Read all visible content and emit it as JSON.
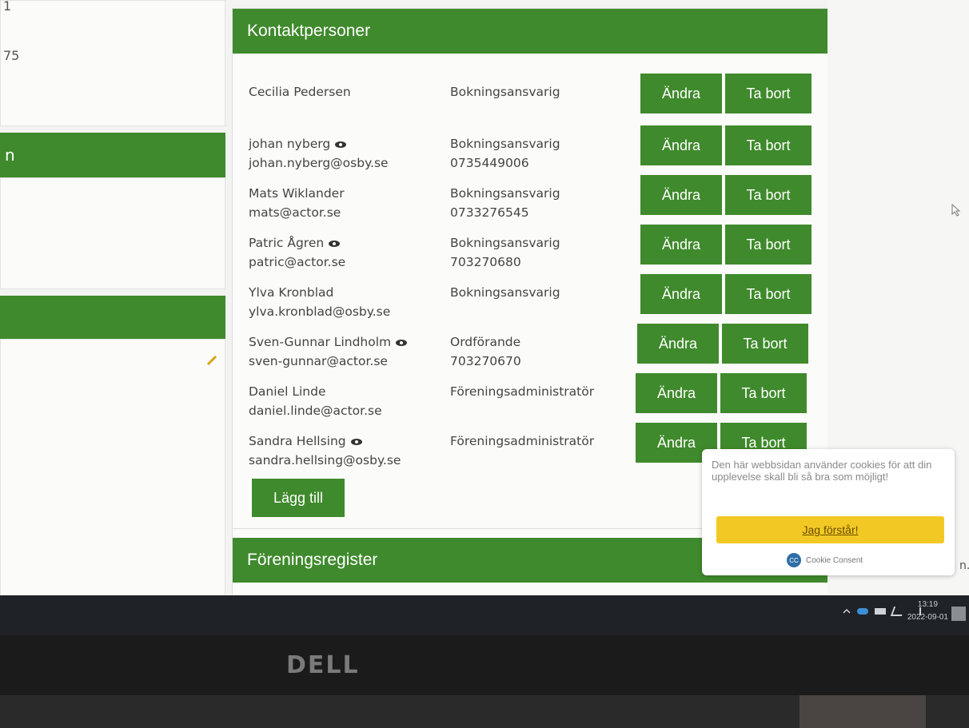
{
  "left_fragments": {
    "top_a": "1",
    "top_b": "75",
    "bar_initial": "n"
  },
  "contacts": {
    "title": "Kontaktpersoner",
    "rows": [
      {
        "name": "Cecilia Pedersen",
        "email": "",
        "role": "Bokningsansvarig",
        "phone": "",
        "eye": false
      },
      {
        "name": "johan nyberg",
        "email": "johan.nyberg@osby.se",
        "role": "Bokningsansvarig",
        "phone": "0735449006",
        "eye": true
      },
      {
        "name": "Mats Wiklander",
        "email": "mats@actor.se",
        "role": "Bokningsansvarig",
        "phone": "0733276545",
        "eye": false
      },
      {
        "name": "Patric Ågren",
        "email": "patric@actor.se",
        "role": "Bokningsansvarig",
        "phone": "703270680",
        "eye": true
      },
      {
        "name": "Ylva Kronblad",
        "email": "ylva.kronblad@osby.se",
        "role": "Bokningsansvarig",
        "phone": "",
        "eye": false
      },
      {
        "name": "Sven-Gunnar Lindholm",
        "email": "sven-gunnar@actor.se",
        "role": "Ordförande",
        "phone": "703270670",
        "eye": true
      },
      {
        "name": "Daniel Linde",
        "email": "daniel.linde@actor.se",
        "role": "Föreningsadministratör",
        "phone": "",
        "eye": false
      },
      {
        "name": "Sandra Hellsing",
        "email": "sandra.hellsing@osby.se",
        "role": "Föreningsadministratör",
        "phone": "",
        "eye": true
      }
    ],
    "edit_label": "Ändra",
    "delete_label": "Ta bort",
    "add_label": "Lägg till"
  },
  "register": {
    "title": "Föreningsregister"
  },
  "cookie": {
    "text": "Den här webbsidan använder cookies för att din upplevelse skall bli så bra som möjligt!",
    "accept_label": "Jag förstår!",
    "brand": "Cookie Consent"
  },
  "page_fragment": "n.",
  "taskbar": {
    "time": "13:19",
    "date": "2022-09-01"
  },
  "bezel": {
    "logo": "DELL"
  },
  "colors": {
    "brand_green": "#3f8a2c",
    "cookie_yellow": "#f2c924"
  }
}
